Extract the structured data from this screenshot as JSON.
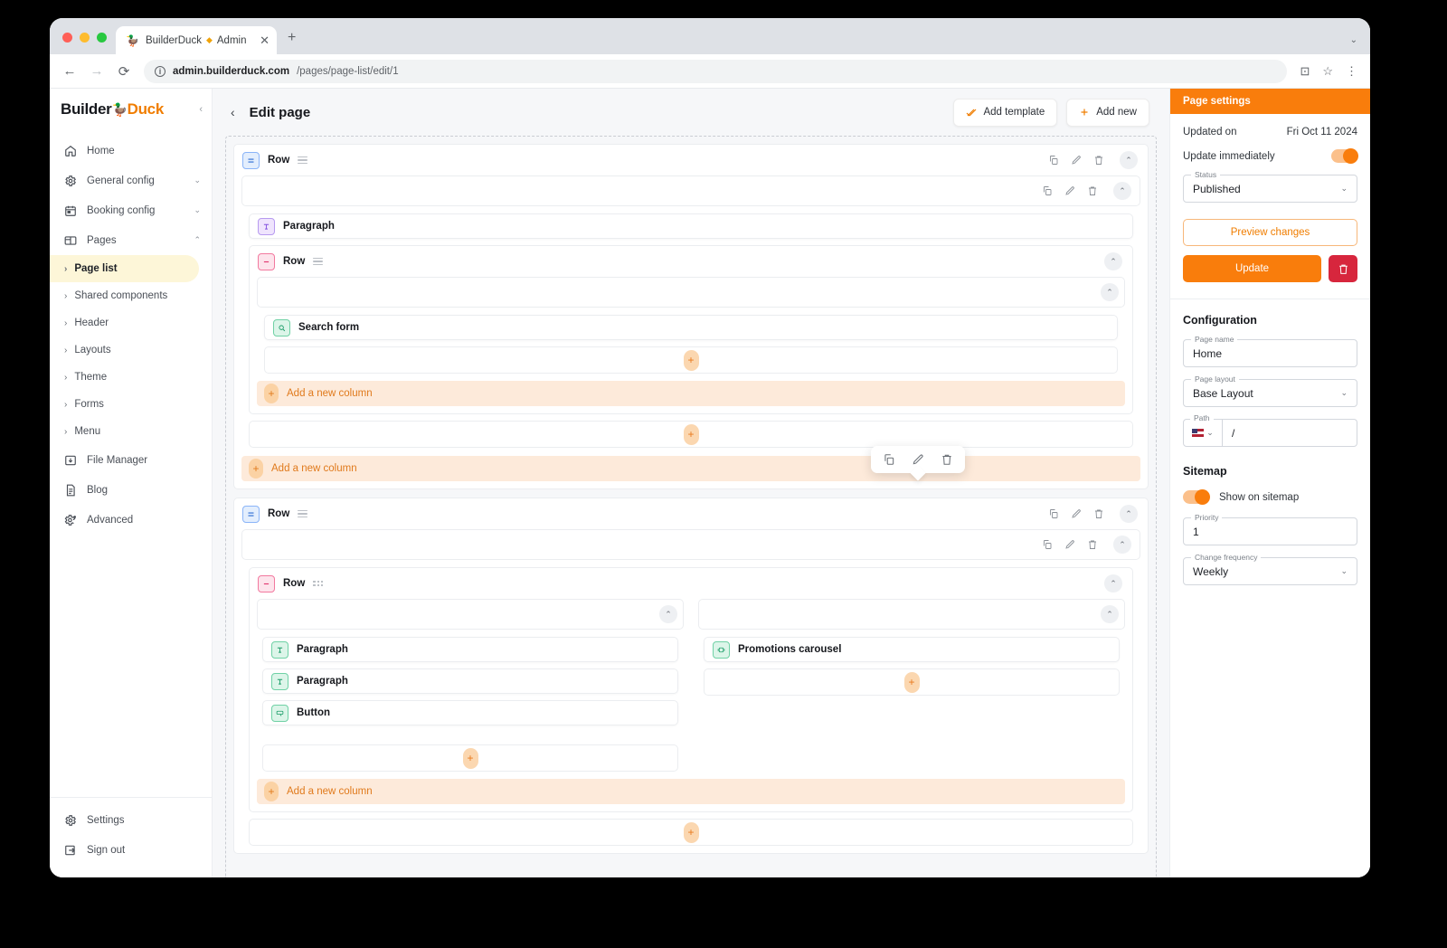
{
  "browser": {
    "tab_title": "BuilderDuck",
    "tab_separator": "◆",
    "tab_subtitle": "Admin",
    "favicon": "🦆",
    "url_domain": "admin.builderduck.com",
    "url_path": "/pages/page-list/edit/1",
    "new_tab_label": "+",
    "close_tab_label": "✕"
  },
  "brand": {
    "name_part1": "Builder",
    "name_part2": "Duck",
    "duck": "🦆"
  },
  "sidebar": {
    "items": [
      {
        "label": "Home",
        "icon": "home-icon",
        "expandable": false
      },
      {
        "label": "General config",
        "icon": "gear-icon",
        "expandable": true,
        "state": "collapsed"
      },
      {
        "label": "Booking config",
        "icon": "calendar-icon",
        "expandable": true,
        "state": "collapsed"
      },
      {
        "label": "Pages",
        "icon": "pages-icon",
        "expandable": true,
        "state": "expanded"
      }
    ],
    "sub_items": [
      {
        "label": "Page list",
        "active": true
      },
      {
        "label": "Shared components",
        "active": false
      },
      {
        "label": "Header",
        "active": false
      },
      {
        "label": "Layouts",
        "active": false
      },
      {
        "label": "Theme",
        "active": false
      },
      {
        "label": "Forms",
        "active": false
      },
      {
        "label": "Menu",
        "active": false
      }
    ],
    "items_after": [
      {
        "label": "File Manager",
        "icon": "file-manager-icon"
      },
      {
        "label": "Blog",
        "icon": "blog-icon"
      },
      {
        "label": "Advanced",
        "icon": "advanced-gear-icon"
      }
    ],
    "footer_items": [
      {
        "label": "Settings",
        "icon": "gear-icon"
      },
      {
        "label": "Sign out",
        "icon": "sign-out-icon"
      }
    ]
  },
  "main": {
    "title": "Edit page",
    "back_label": "‹",
    "add_template_label": "Add template",
    "add_new_label": "Add new",
    "row_label": "Row",
    "add_column_label": "Add a new column",
    "components": {
      "paragraph": "Paragraph",
      "search_form": "Search form",
      "promotions_carousel": "Promotions carousel",
      "button": "Button"
    }
  },
  "settings": {
    "header": "Page settings",
    "updated_on_label": "Updated on",
    "updated_on_value": "Fri Oct 11 2024",
    "update_immediately_label": "Update immediately",
    "update_immediately_on": true,
    "status_label": "Status",
    "status_value": "Published",
    "preview_label": "Preview changes",
    "update_label": "Update",
    "delete_icon": "trash-icon",
    "configuration_heading": "Configuration",
    "page_name_label": "Page name",
    "page_name_value": "Home",
    "page_layout_label": "Page layout",
    "page_layout_value": "Base Layout",
    "path_label": "Path",
    "path_value": "/",
    "sitemap_heading": "Sitemap",
    "show_on_sitemap_label": "Show on sitemap",
    "show_on_sitemap_on": true,
    "priority_label": "Priority",
    "priority_value": "1",
    "change_frequency_label": "Change frequency",
    "change_frequency_value": "Weekly"
  },
  "colors": {
    "accent": "#f97d0c",
    "danger": "#d7263d",
    "active_nav": "#fdf6d8",
    "row_blue": "#8ab4f8",
    "row_pink": "#f2799f",
    "paragraph_purple": "#b79af0",
    "component_green": "#6fd1a5"
  }
}
